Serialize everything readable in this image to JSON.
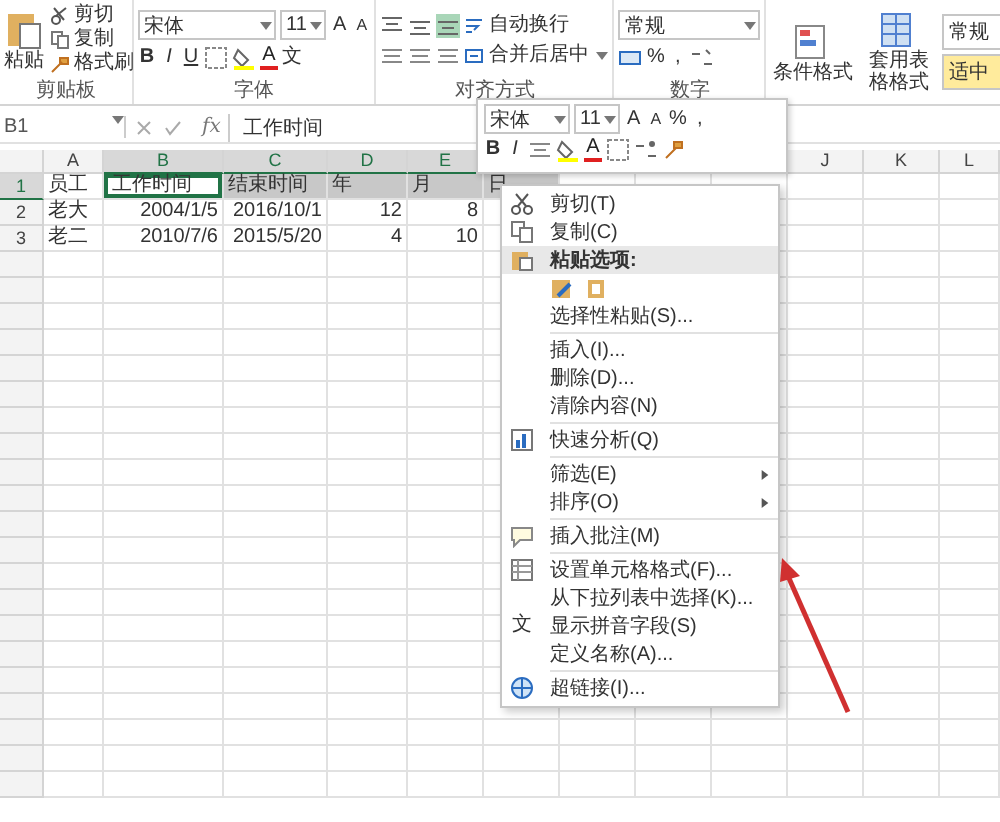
{
  "ribbon": {
    "clipboard": {
      "paste": "粘贴",
      "tools": [
        "剪切",
        "复制",
        "格式刷"
      ],
      "label": "剪贴板"
    },
    "font": {
      "font_name": "宋体",
      "font_size": "11",
      "grow": "A",
      "shrink": "A",
      "styles": [
        "B",
        "I",
        "U"
      ],
      "font_color": "A",
      "phonetic": "文",
      "label": "字体"
    },
    "alignment": {
      "wrap_text": "自动换行",
      "merge": "合并后居中",
      "label": "对齐方式"
    },
    "number": {
      "format": "常规",
      "percent": "%",
      "comma": ",",
      "label": "数字"
    },
    "styles": {
      "conditional": "条件格式",
      "format_table": "套用表格格式",
      "cell_styles": [
        {
          "label": "常规",
          "color": "#ffffff"
        },
        {
          "label": "适中",
          "color": "#ffeb9c"
        }
      ]
    }
  },
  "formula_bar": {
    "name_box": "B1",
    "fx": "fx",
    "value": "工作时间"
  },
  "sheet": {
    "columns": [
      {
        "label": "A",
        "selected": false
      },
      {
        "label": "B",
        "selected": true
      },
      {
        "label": "C",
        "selected": true
      },
      {
        "label": "D",
        "selected": true
      },
      {
        "label": "E",
        "selected": true
      },
      {
        "label": "J",
        "selected": false
      },
      {
        "label": "K",
        "selected": false
      },
      {
        "label": "L",
        "selected": false
      }
    ],
    "rows": [
      {
        "number": "1",
        "selected": true,
        "cells": [
          {
            "text": "员工",
            "kind": "text",
            "selected": false,
            "active": false
          },
          {
            "text": "工作时间",
            "kind": "text",
            "selected": false,
            "active": true
          },
          {
            "text": "结束时间",
            "kind": "text",
            "selected": true,
            "active": false
          },
          {
            "text": "年",
            "kind": "text",
            "selected": true,
            "active": false
          },
          {
            "text": "月",
            "kind": "text",
            "selected": true,
            "active": false
          },
          {
            "text": "日",
            "kind": "text",
            "selected": true,
            "active": false
          }
        ]
      },
      {
        "number": "2",
        "selected": false,
        "cells": [
          {
            "text": "老大",
            "kind": "text",
            "selected": false,
            "active": false
          },
          {
            "text": "2004/1/5",
            "kind": "number",
            "selected": false,
            "active": false
          },
          {
            "text": "2016/10/1",
            "kind": "number",
            "selected": false,
            "active": false
          },
          {
            "text": "12",
            "kind": "number",
            "selected": false,
            "active": false
          },
          {
            "text": "8",
            "kind": "number",
            "selected": false,
            "active": false
          }
        ]
      },
      {
        "number": "3",
        "selected": false,
        "cells": [
          {
            "text": "老二",
            "kind": "text",
            "selected": false,
            "active": false
          },
          {
            "text": "2010/7/6",
            "kind": "number",
            "selected": false,
            "active": false
          },
          {
            "text": "2015/5/20",
            "kind": "number",
            "selected": false,
            "active": false
          },
          {
            "text": "4",
            "kind": "number",
            "selected": false,
            "active": false
          },
          {
            "text": "10",
            "kind": "number",
            "selected": false,
            "active": false
          }
        ]
      }
    ]
  },
  "mini_toolbar": {
    "font_name": "宋体",
    "font_size": "11",
    "grow": "A",
    "shrink": "A",
    "percent": "%",
    "comma": ",",
    "bold": "B",
    "italic": "I",
    "font_color": "A"
  },
  "context_menu": {
    "items": [
      {
        "kind": "cut",
        "label": "剪切(T)"
      },
      {
        "kind": "copy",
        "label": "复制(C)"
      },
      {
        "kind": "pasteheader",
        "label": "粘贴选项:"
      },
      {
        "kind": "pasteicons"
      },
      {
        "kind": "plain",
        "label": "选择性粘贴(S)..."
      },
      {
        "kind": "separator"
      },
      {
        "kind": "plain",
        "label": "插入(I)..."
      },
      {
        "kind": "plain",
        "label": "删除(D)..."
      },
      {
        "kind": "plain",
        "label": "清除内容(N)"
      },
      {
        "kind": "separator"
      },
      {
        "kind": "quick",
        "label": "快速分析(Q)"
      },
      {
        "kind": "separator"
      },
      {
        "kind": "submenu",
        "label": "筛选(E)"
      },
      {
        "kind": "submenu",
        "label": "排序(O)"
      },
      {
        "kind": "separator"
      },
      {
        "kind": "comment",
        "label": "插入批注(M)"
      },
      {
        "kind": "separator"
      },
      {
        "kind": "format",
        "label": "设置单元格格式(F)..."
      },
      {
        "kind": "plain",
        "label": "从下拉列表中选择(K)..."
      },
      {
        "kind": "phonetic",
        "label": "显示拼音字段(S)",
        "glyph": "文"
      },
      {
        "kind": "plain",
        "label": "定义名称(A)..."
      },
      {
        "kind": "separator"
      },
      {
        "kind": "link",
        "label": "超链接(I)..."
      }
    ]
  }
}
